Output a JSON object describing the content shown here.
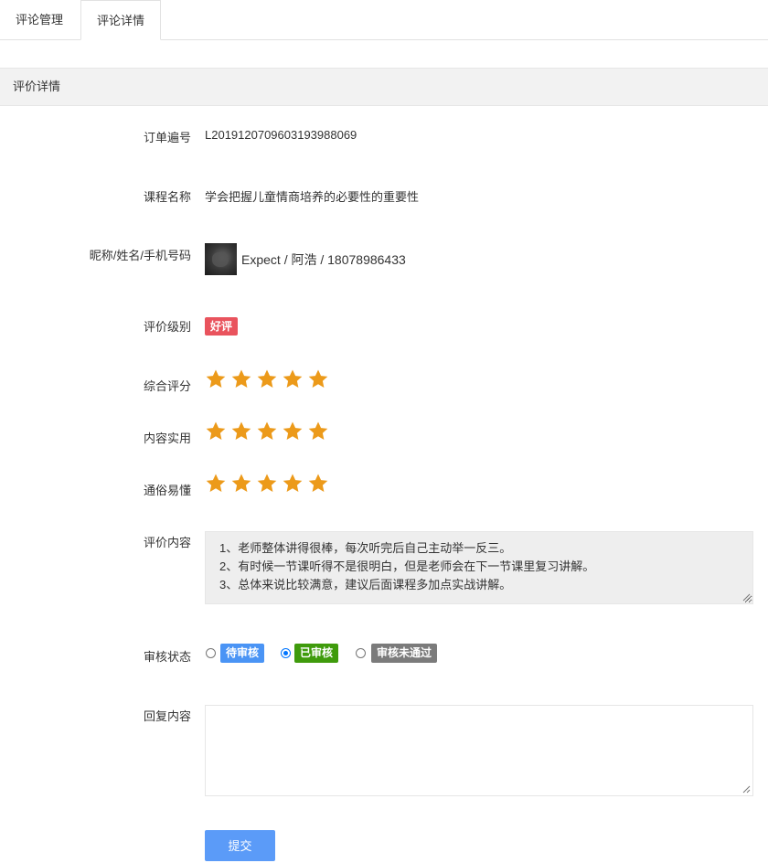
{
  "tabs": [
    {
      "label": "评论管理",
      "active": false
    },
    {
      "label": "评论详情",
      "active": true
    }
  ],
  "section": {
    "title": "评价详情"
  },
  "fields": {
    "order_no": {
      "label": "订单遍号",
      "value": "L2019120709603193988069"
    },
    "course": {
      "label": "课程名称",
      "value": "学会把握儿童情商培养的必要性的重要性"
    },
    "user": {
      "label": "昵称/姓名/手机号码",
      "value": "Expect / 阿浩 / 18078986433",
      "avatar_icon": "user-avatar"
    },
    "level": {
      "label": "评价级别",
      "badge": "好评",
      "badge_color": "#e9535d"
    },
    "overall": {
      "label": "综合评分",
      "rating": 5,
      "max": 5
    },
    "practical": {
      "label": "内容实用",
      "rating": 5,
      "max": 5
    },
    "easy": {
      "label": "通俗易懂",
      "rating": 5,
      "max": 5
    },
    "content": {
      "label": "评价内容",
      "lines": [
        "1、老师整体讲得很棒，每次听完后自己主动举一反三。",
        "2、有时候一节课听得不是很明白，但是老师会在下一节课里复习讲解。",
        "3、总体来说比较满意，建议后面课程多加点实战讲解。"
      ]
    },
    "review_status": {
      "label": "审核状态",
      "options": [
        {
          "label": "待审核",
          "color": "#4a94f5",
          "checked": false
        },
        {
          "label": "已审核",
          "color": "#3f9b0c",
          "checked": true
        },
        {
          "label": "审核未通过",
          "color": "#7b7b7b",
          "checked": false
        }
      ]
    },
    "reply": {
      "label": "回复内容",
      "value": ""
    }
  },
  "submit": {
    "label": "提交"
  },
  "colors": {
    "star": "#ec9a1a",
    "accent": "#5b9bf8"
  }
}
